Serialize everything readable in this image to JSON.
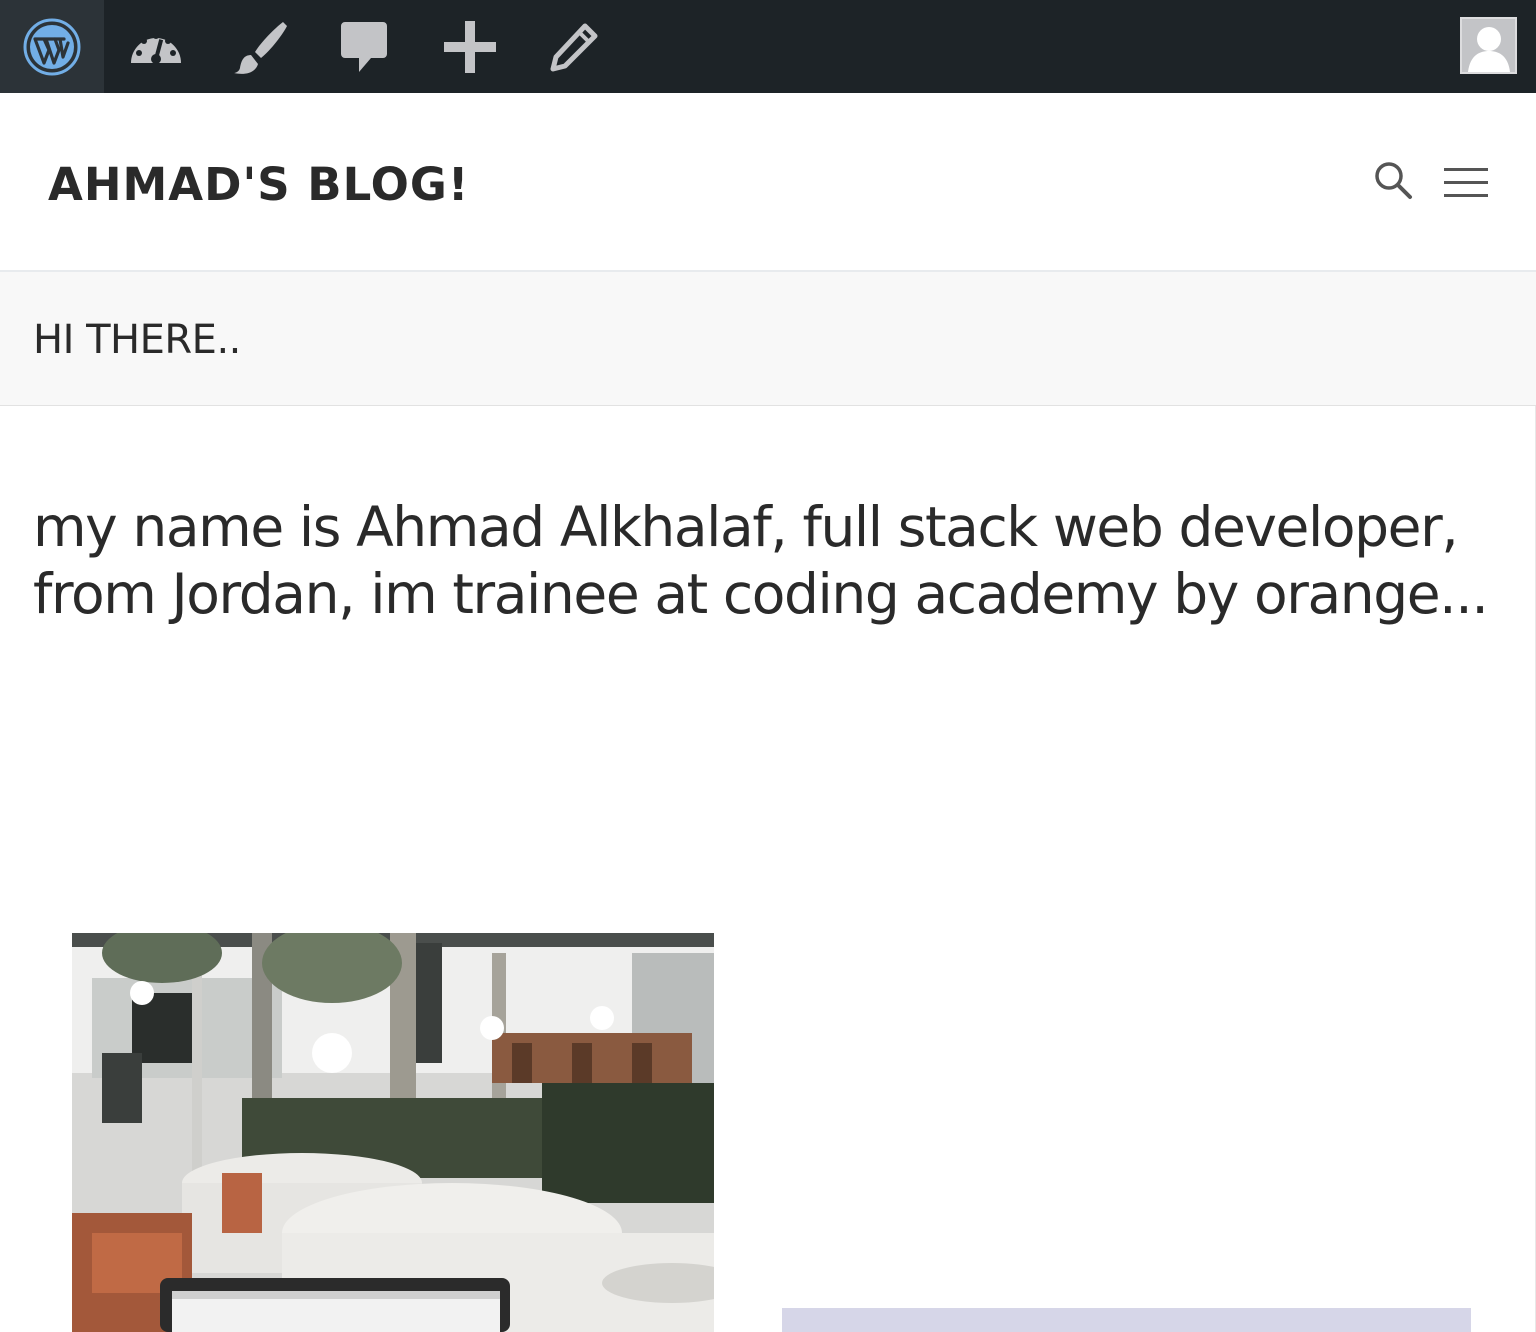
{
  "admin_bar": {
    "items": [
      {
        "name": "wordpress-logo",
        "icon": "wordpress-icon"
      },
      {
        "name": "dashboard",
        "icon": "dashboard-icon"
      },
      {
        "name": "customize",
        "icon": "brush-icon"
      },
      {
        "name": "comments",
        "icon": "comment-icon"
      },
      {
        "name": "new-content",
        "icon": "plus-icon"
      },
      {
        "name": "edit-page",
        "icon": "pencil-icon"
      }
    ],
    "account_icon": "avatar-icon"
  },
  "header": {
    "site_title": "AHMAD'S BLOG!",
    "search_icon": "search-icon",
    "menu_icon": "hamburger-menu-icon"
  },
  "page": {
    "title": "HI THERE..",
    "intro": "my name is Ahmad Alkhalaf, full stack web developer, from Jordan, im trainee at coding academy by orange..."
  },
  "colors": {
    "admin_bar_bg": "#1d2327",
    "admin_bar_active": "#2c3338",
    "icon_gray": "#c3c4c7",
    "wp_blue": "#72aee6",
    "text_dark": "#2a2a2a",
    "band_bg": "#f8f8f8"
  }
}
